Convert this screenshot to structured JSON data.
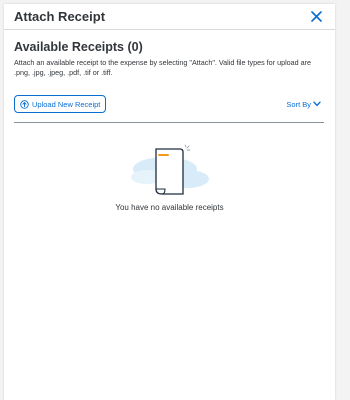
{
  "dialog": {
    "title": "Attach Receipt"
  },
  "section": {
    "title": "Available Receipts (0)",
    "description": "Attach an available receipt to the expense by selecting \"Attach\". Valid file types for upload are .png, .jpg, .jpeg, .pdf, .tif or .tiff."
  },
  "toolbar": {
    "upload_label": "Upload New Receipt",
    "sort_label": "Sort By"
  },
  "empty_state": {
    "message": "You have no available receipts"
  },
  "colors": {
    "accent": "#0a6ed1",
    "illustration_bg": "#d7ecf8",
    "illustration_stroke": "#1d2d3e",
    "illustration_highlight": "#f29b1d"
  },
  "icons": {
    "close": "close-icon",
    "upload": "upload-icon",
    "sort": "chevron-down-icon",
    "illustration": "empty-document-illustration"
  }
}
